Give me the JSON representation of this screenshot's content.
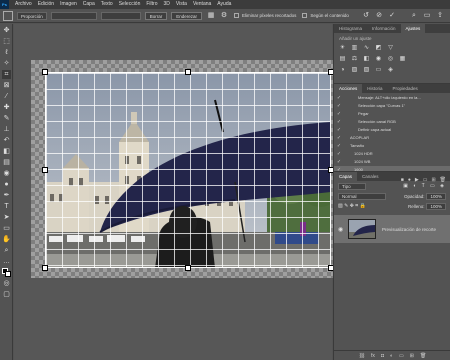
{
  "menubar": {
    "logo": "Ps",
    "items": [
      "Archivo",
      "Edición",
      "Imagen",
      "Capa",
      "Texto",
      "Selección",
      "Filtro",
      "3D",
      "Vista",
      "Ventana",
      "Ayuda"
    ]
  },
  "options": {
    "ratio": "Proporción",
    "clear": "Borrar",
    "straighten": "Enderezar",
    "delete_cropped": "Eliminar píxeles recortados",
    "content_aware": "Según el contenido"
  },
  "panels": {
    "top_tabs": [
      "Histograma",
      "Información",
      "Ajustes"
    ],
    "adjust_hint": "Añadir un ajuste",
    "history_tabs": [
      "Acciones",
      "Historia",
      "Propiedades"
    ],
    "layers_tabs": [
      "Capas",
      "Canales"
    ],
    "blend_mode": "Normal",
    "opacity_label": "Opacidad:",
    "opacity": "100%",
    "fill_label": "Relleno:",
    "fill": "100%",
    "kind": "Tipo"
  },
  "history": [
    {
      "label": "Mensaje: ALT+clic izquierdo en la...",
      "checked": true
    },
    {
      "label": "Selección capa \"Curvas 1\"",
      "checked": true
    },
    {
      "label": "Pegar",
      "checked": true
    },
    {
      "label": "Selección canal RGB",
      "checked": true
    },
    {
      "label": "Definir capa actual",
      "checked": true
    },
    {
      "label": "ACOPLAR",
      "checked": true
    },
    {
      "label": "Tamaño",
      "checked": true
    },
    {
      "label": "1024 HDR",
      "checked": true
    },
    {
      "label": "1024 WB",
      "checked": true
    },
    {
      "label": "1600",
      "checked": true,
      "selected": true
    }
  ],
  "layer": {
    "name": "Previsualización de recorte"
  },
  "colors": {
    "accent": "#31a8ff",
    "panel": "#535353",
    "dark": "#3e3e3e"
  }
}
